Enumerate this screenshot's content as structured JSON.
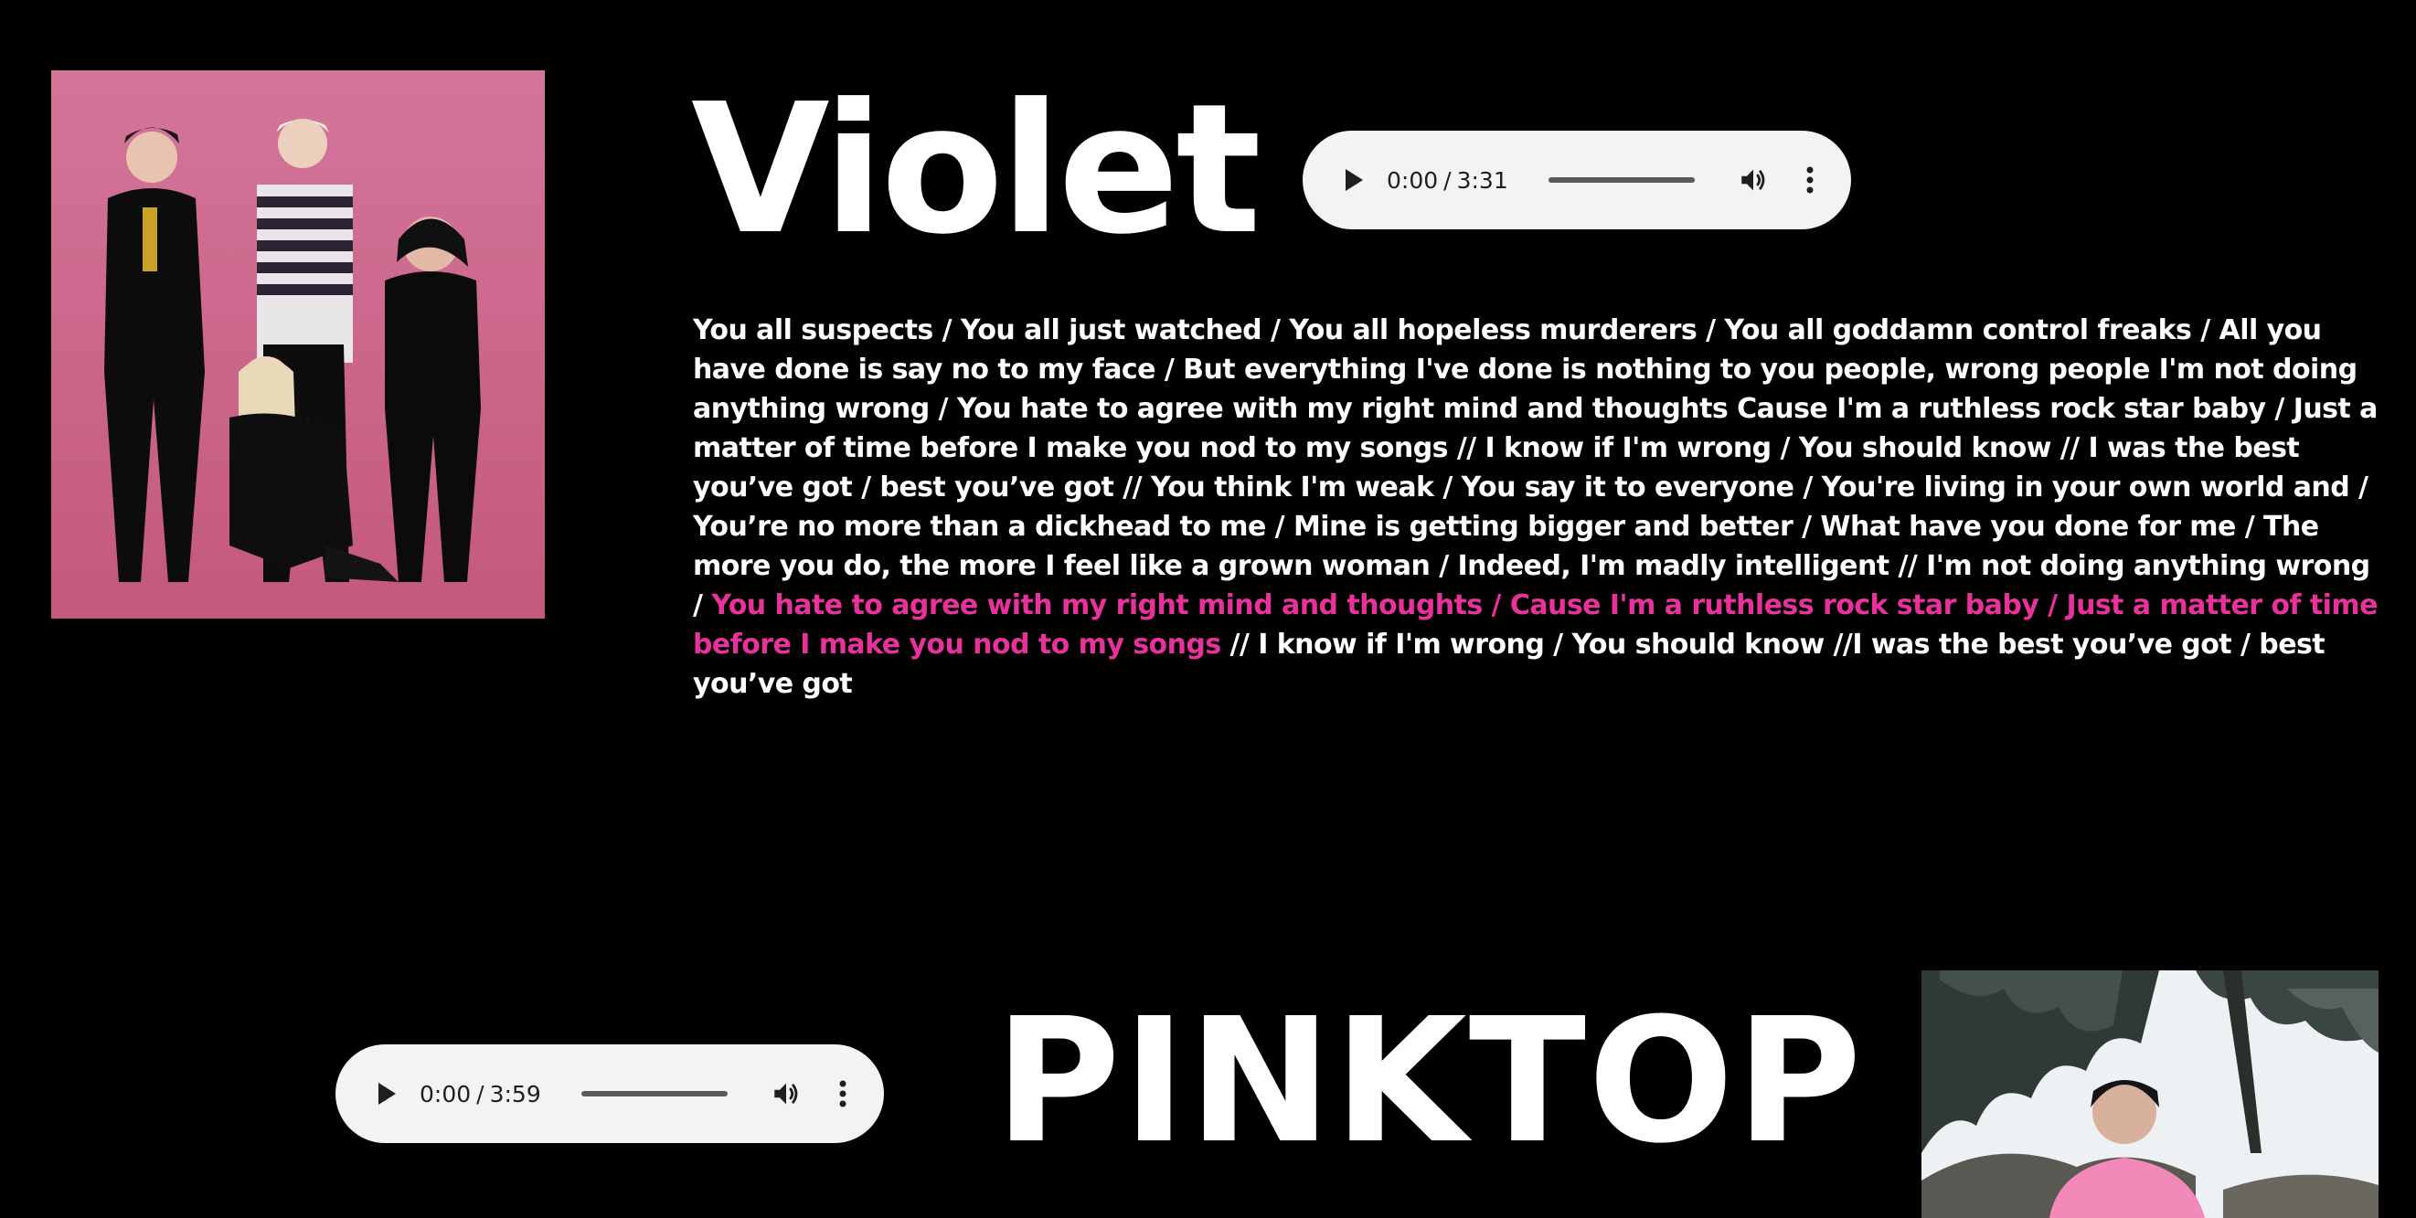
{
  "songs": [
    {
      "title": "Violet",
      "cover_alt": "band-photo",
      "player": {
        "current_time": "0:00",
        "duration": "3:31",
        "separator": "/",
        "progress": 0
      },
      "lyrics": {
        "before": "You all suspects / You all just watched / You all hopeless murderers / You all goddamn control freaks / All you have done is say no to my face / But everything I've done is nothing to you people, wrong people I'm not doing anything wrong / You hate to agree with my right mind and thoughts Cause I'm a ruthless rock star baby / Just a matter of time before I make you nod to my songs // I know if I'm wrong / You should know // I was the best you’ve got / best you’ve got // You think I'm weak / You say it to everyone / You're living in your own world and / You’re no more than a dickhead to me / Mine is getting bigger and better / What have you done for me / The more you do, the more I feel like a grown woman / Indeed, I'm madly intelligent // I'm not doing anything wrong / ",
        "highlight": "You hate to agree with my right mind and thoughts / Cause I'm a ruthless rock star baby / Just a matter of time before I make you nod to my songs",
        "after": " // I know if I'm wrong / You should know //I was the best you’ve got / best you’ve got",
        "highlight_color": "#e8319a"
      }
    },
    {
      "title": "PINKTOP",
      "cover_alt": "portrait-photo",
      "player": {
        "current_time": "0:00",
        "duration": "3:59",
        "separator": "/",
        "progress": 0
      }
    }
  ],
  "colors": {
    "background": "#000000",
    "text": "#ffffff",
    "accent": "#e8319a",
    "player_bg": "#f1f3f4"
  },
  "icons": {
    "play": "play-icon",
    "volume": "volume-icon",
    "more": "more-vertical-icon"
  }
}
